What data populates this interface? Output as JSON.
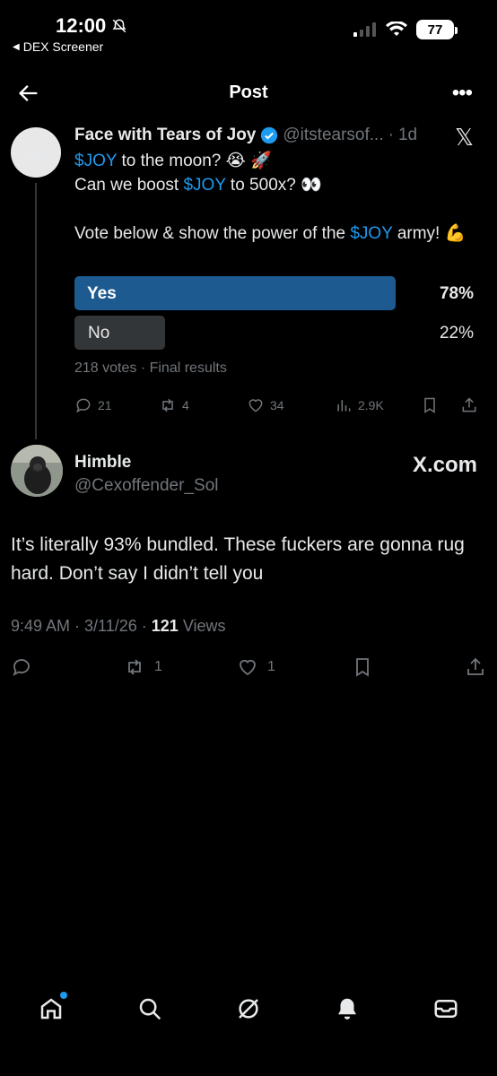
{
  "status_bar": {
    "time": "12:00",
    "back_app": "DEX Screener",
    "battery": "77"
  },
  "nav": {
    "title": "Post"
  },
  "tweet": {
    "author_name": "Face with Tears of Joy",
    "handle": "@itstearsof...",
    "time": "1d",
    "line1_cash": "$JOY",
    "line1_rest": " to the moon? 😭 🚀",
    "line2_pre": "Can we boost ",
    "line2_cash": "$JOY",
    "line2_rest": " to 500x? 👀",
    "line3_pre": "Vote below & show the power of the ",
    "line3_cash": "$JOY",
    "line3_rest": " army! 💪",
    "poll": {
      "options": [
        {
          "label": "Yes",
          "percent": "78%",
          "value": 78
        },
        {
          "label": "No",
          "percent": "22%",
          "value": 22
        }
      ],
      "meta": "218 votes · Final results"
    },
    "actions": {
      "replies": "21",
      "reposts": "4",
      "likes": "34",
      "views": "2.9K"
    }
  },
  "reply": {
    "author_name": "Himble",
    "handle": "@Cexoffender_Sol",
    "watermark": "X.com",
    "text": "It’s literally 93% bundled. These fuckers are gonna rug hard. Don’t say I didn’t tell you",
    "meta_time": "9:49 AM · 3/11/26 · ",
    "views_count": "121",
    "views_label": " Views",
    "actions": {
      "reposts": "1",
      "likes": "1"
    }
  },
  "colors": {
    "accent": "#1d9bf0",
    "poll_winner": "#1c5a8f",
    "poll_loser": "#333639",
    "muted": "#71767b"
  },
  "icons": [
    "home-icon",
    "search-icon",
    "grok-icon",
    "notifications-icon",
    "messages-icon"
  ]
}
